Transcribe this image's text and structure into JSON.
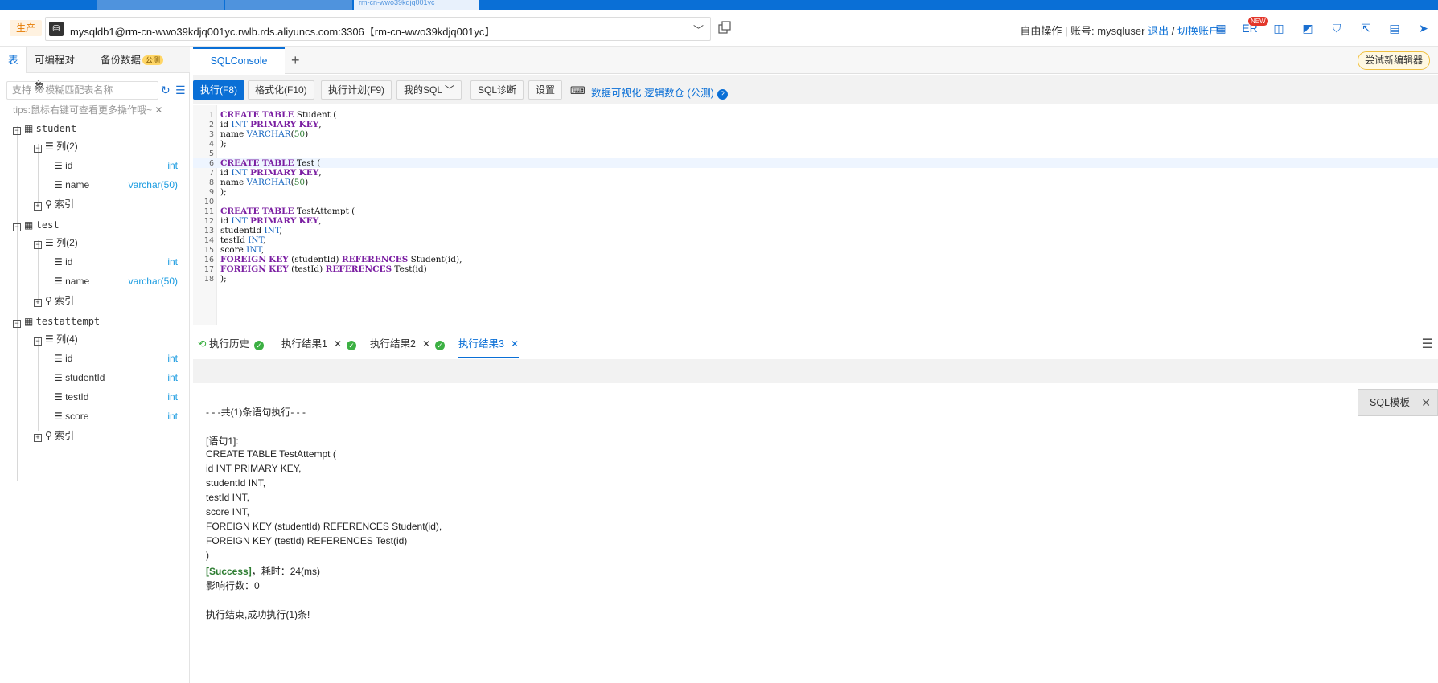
{
  "window": {
    "active_tab": "rm-cn-wwo39kdjq001yc"
  },
  "header": {
    "env_badge": "生产",
    "connection": "mysqldb1@rm-cn-wwo39kdjq001yc.rwlb.rds.aliyuncs.com:3306【rm-cn-wwo39kdjq001yc】",
    "mode": "自由操作",
    "account_label": "账号: mysqluser",
    "logout": "退出",
    "switch_account": "切换账户",
    "er_label": "ER",
    "new_badge": "NEW"
  },
  "left_panel": {
    "tabs": [
      "表",
      "可编程对象",
      "备份数据"
    ],
    "beta_badge": "公测",
    "search_placeholder": "支持 % 模糊匹配表名称",
    "tips": "tips:鼠标右键可查看更多操作哦~",
    "tables": [
      {
        "name": "student",
        "columns_label": "列(2)",
        "columns": [
          {
            "name": "id",
            "type": "int"
          },
          {
            "name": "name",
            "type": "varchar(50)"
          }
        ],
        "index_label": "索引"
      },
      {
        "name": "test",
        "columns_label": "列(2)",
        "columns": [
          {
            "name": "id",
            "type": "int"
          },
          {
            "name": "name",
            "type": "varchar(50)"
          }
        ],
        "index_label": "索引"
      },
      {
        "name": "testattempt",
        "columns_label": "列(4)",
        "columns": [
          {
            "name": "id",
            "type": "int"
          },
          {
            "name": "studentId",
            "type": "int"
          },
          {
            "name": "testId",
            "type": "int"
          },
          {
            "name": "score",
            "type": "int"
          }
        ],
        "index_label": "索引"
      }
    ]
  },
  "editor_tabs": {
    "active": "SQLConsole",
    "add": "+",
    "try_new_editor": "尝试新编辑器"
  },
  "toolbar": {
    "execute": "执行(F8)",
    "format": "格式化(F10)",
    "plan": "执行计划(F9)",
    "my_sql": "我的SQL",
    "diagnose": "SQL诊断",
    "settings": "设置",
    "visualize": "数据可视化",
    "logic_warehouse": "逻辑数仓 (公测)"
  },
  "sql_lines": [
    "CREATE TABLE Student (",
    "id INT PRIMARY KEY,",
    "name VARCHAR(50)",
    ");",
    "",
    "CREATE TABLE Test (",
    "id INT PRIMARY KEY,",
    "name VARCHAR(50)",
    ");",
    "",
    "CREATE TABLE TestAttempt (",
    "id INT PRIMARY KEY,",
    "studentId INT,",
    "testId INT,",
    "score INT,",
    "FOREIGN KEY (studentId) REFERENCES Student(id),",
    "FOREIGN KEY (testId) REFERENCES Test(id)",
    ");"
  ],
  "result_tabs": {
    "history": "执行历史",
    "r1": "执行结果1",
    "r2": "执行结果2",
    "r3": "执行结果3"
  },
  "result": {
    "summary": "- - -共(1)条语句执行- - -",
    "stmt_label": "[语句1]:",
    "stmt_lines": [
      "CREATE TABLE TestAttempt (",
      "id INT PRIMARY KEY,",
      "studentId INT,",
      "testId INT,",
      "score INT,",
      "FOREIGN KEY (studentId) REFERENCES Student(id),",
      "FOREIGN KEY (testId) REFERENCES Test(id)",
      ")"
    ],
    "success": "[Success]",
    "timing": "，耗时：24(ms)",
    "affected": "影响行数：0",
    "done": "执行结束,成功执行(1)条!",
    "sql_template": "SQL模板"
  }
}
